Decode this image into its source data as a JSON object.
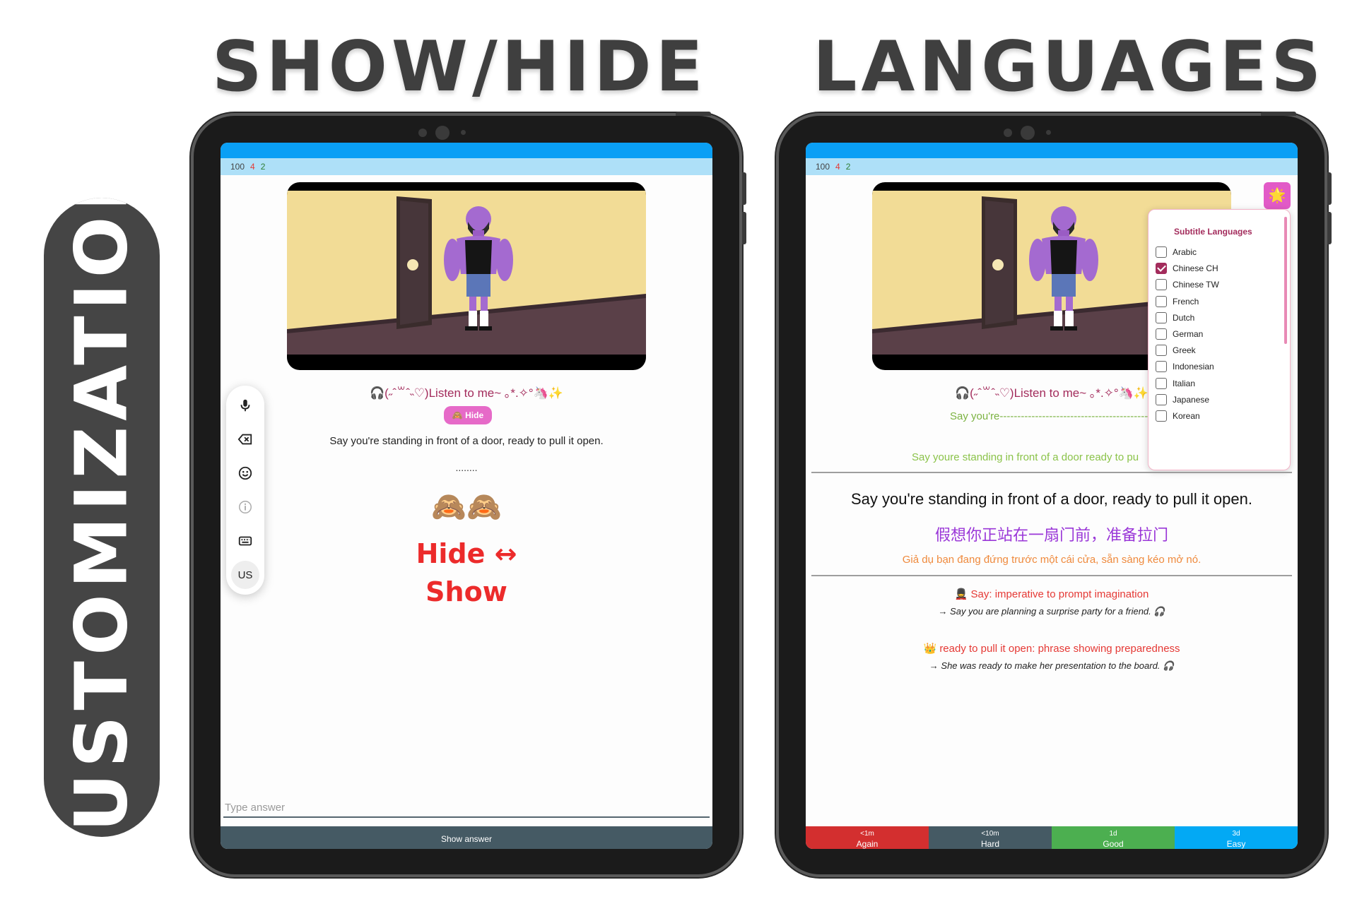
{
  "headings": {
    "left": "SHOW/HIDE",
    "right": "LANGUAGES",
    "side": "CUSTOMIZATION"
  },
  "counts": {
    "new": "100",
    "learn": "4",
    "review": "2"
  },
  "listen_text": "🎧(˶ˆ꒳ˆ˵♡)Listen to me~ ｡*.✧°🦄✨",
  "left_card": {
    "hide_label": "🙈 Hide",
    "sentence": "Say you're standing in front of a door, ready to pull it open.",
    "dots": "........",
    "monkeys": "🙈🙈",
    "hide_show_1": "Hide ↔",
    "hide_show_2": "Show",
    "toolbar": {
      "icons": [
        "microphone-icon",
        "backspace-icon",
        "emoji-icon",
        "info-icon",
        "keyboard-icon"
      ],
      "us_label": "US"
    },
    "answer_placeholder": "Type answer",
    "show_answer_label": "Show answer"
  },
  "right_card": {
    "star": "🌟",
    "languages_title": "Subtitle Languages",
    "languages": [
      {
        "name": "Arabic",
        "checked": false
      },
      {
        "name": "Chinese CH",
        "checked": true
      },
      {
        "name": "Chinese TW",
        "checked": false
      },
      {
        "name": "French",
        "checked": false
      },
      {
        "name": "Dutch",
        "checked": false
      },
      {
        "name": "German",
        "checked": false
      },
      {
        "name": "Greek",
        "checked": false
      },
      {
        "name": "Indonesian",
        "checked": false
      },
      {
        "name": "Italian",
        "checked": false
      },
      {
        "name": "Japanese",
        "checked": false
      },
      {
        "name": "Korean",
        "checked": false
      }
    ],
    "partial_typed": "Say you're-------------------------------------------------",
    "partial_compare": "Say youre standing in front of a door ready to pu",
    "sentence": "Say you're standing in front of a door, ready to pull it open.",
    "chinese": "假想你正站在一扇门前，准备拉门",
    "vietnamese": "Giả dụ bạn đang đứng trước một cái cửa, sẵn sàng kéo mở nó.",
    "notes": [
      {
        "title": "💂 Say: imperative to prompt imagination",
        "example": "→ Say you are planning a surprise party for a friend. 🎧"
      },
      {
        "title": "👑 ready to pull it open: phrase showing preparedness",
        "example": "→ She was ready to make her presentation to the board. 🎧"
      }
    ],
    "rating": [
      {
        "time": "<1m",
        "label": "Again"
      },
      {
        "time": "<10m",
        "label": "Hard"
      },
      {
        "time": "1d",
        "label": "Good"
      },
      {
        "time": "3d",
        "label": "Easy"
      }
    ]
  },
  "colors": {
    "accent_pink": "#a32c5c",
    "status_blue": "#0a9ff5",
    "hide_show_red": "#ec2b2b"
  }
}
